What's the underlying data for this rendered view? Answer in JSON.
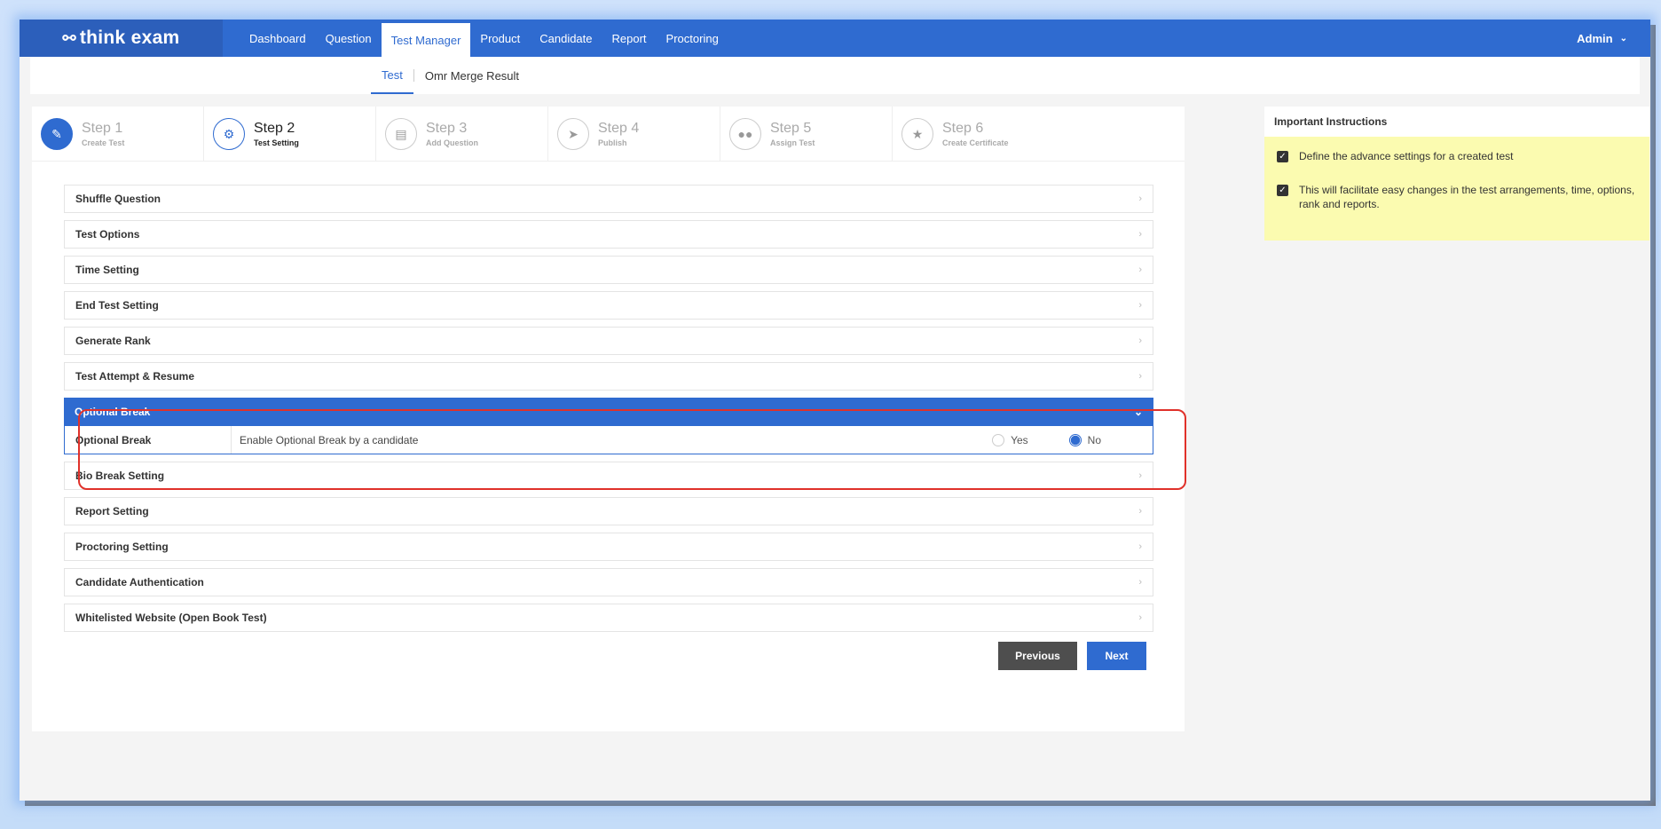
{
  "brand": {
    "logo_text": "think exam"
  },
  "nav": {
    "items": [
      {
        "label": "Dashboard"
      },
      {
        "label": "Question"
      },
      {
        "label": "Test Manager"
      },
      {
        "label": "Product"
      },
      {
        "label": "Candidate"
      },
      {
        "label": "Report"
      },
      {
        "label": "Proctoring"
      }
    ],
    "user_label": "Admin"
  },
  "subnav": {
    "tabs": [
      {
        "label": "Test"
      },
      {
        "label": "Omr Merge Result"
      }
    ]
  },
  "steps": [
    {
      "title": "Step 1",
      "subtitle": "Create Test"
    },
    {
      "title": "Step 2",
      "subtitle": "Test Setting"
    },
    {
      "title": "Step 3",
      "subtitle": "Add Question"
    },
    {
      "title": "Step 4",
      "subtitle": "Publish"
    },
    {
      "title": "Step 5",
      "subtitle": "Assign Test"
    },
    {
      "title": "Step 6",
      "subtitle": "Create Certificate"
    }
  ],
  "accordion": {
    "before": [
      {
        "label": "Shuffle Question"
      },
      {
        "label": "Test Options"
      },
      {
        "label": "Time Setting"
      },
      {
        "label": "End Test Setting"
      },
      {
        "label": "Generate Rank"
      },
      {
        "label": "Test Attempt & Resume"
      }
    ],
    "open": {
      "label": "Optional Break",
      "row_label": "Optional Break",
      "row_desc": "Enable Optional Break by a candidate",
      "options": [
        {
          "label": "Yes",
          "selected": false
        },
        {
          "label": "No",
          "selected": true
        }
      ]
    },
    "after": [
      {
        "label": "Bio Break Setting"
      },
      {
        "label": "Report Setting"
      },
      {
        "label": "Proctoring Setting"
      },
      {
        "label": "Candidate Authentication"
      },
      {
        "label": "Whitelisted Website (Open Book Test)"
      }
    ]
  },
  "buttons": {
    "previous": "Previous",
    "next": "Next"
  },
  "instructions": {
    "title": "Important Instructions",
    "items": [
      "Define the advance settings for a created test",
      "This will facilitate easy changes in the test arrangements, time, options, rank and reports."
    ]
  },
  "colors": {
    "primary": "#2f6bd0",
    "highlight": "#e0312a",
    "instructions_bg": "#fbfbb0"
  }
}
